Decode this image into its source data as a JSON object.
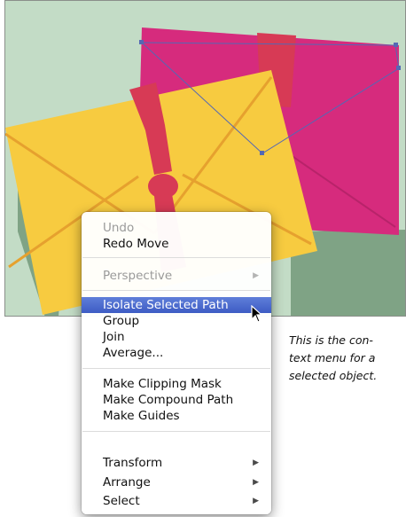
{
  "colors": {
    "canvas_background": "#c3dcc6",
    "shadow": "#7fa385",
    "pink_envelope": "#d62b7d",
    "yellow_envelope": "#f7cb40",
    "ribbon": "#d73a55",
    "selection_path": "#5468b4",
    "menu_highlight": "#4a68cc"
  },
  "context_menu": {
    "items": [
      {
        "label": "Undo",
        "enabled": false,
        "highlighted": false,
        "submenu": false
      },
      {
        "label": "Redo Move",
        "enabled": true,
        "highlighted": false,
        "submenu": false
      },
      {
        "label": "Perspective",
        "enabled": false,
        "highlighted": false,
        "submenu": true
      },
      {
        "label": "Isolate Selected Path",
        "enabled": true,
        "highlighted": true,
        "submenu": false
      },
      {
        "label": "Group",
        "enabled": true,
        "highlighted": false,
        "submenu": false
      },
      {
        "label": "Join",
        "enabled": true,
        "highlighted": false,
        "submenu": false
      },
      {
        "label": "Average...",
        "enabled": true,
        "highlighted": false,
        "submenu": false
      },
      {
        "label": "Make Clipping Mask",
        "enabled": true,
        "highlighted": false,
        "submenu": false
      },
      {
        "label": "Make Compound Path",
        "enabled": true,
        "highlighted": false,
        "submenu": false
      },
      {
        "label": "Make Guides",
        "enabled": true,
        "highlighted": false,
        "submenu": false
      },
      {
        "label": "Transform",
        "enabled": true,
        "highlighted": false,
        "submenu": true
      },
      {
        "label": "Arrange",
        "enabled": true,
        "highlighted": false,
        "submenu": true
      },
      {
        "label": "Select",
        "enabled": true,
        "highlighted": false,
        "submenu": true
      }
    ],
    "submenu_arrow": "▶"
  },
  "caption": {
    "lines": [
      "This is the con-",
      "text menu for a",
      "selected object."
    ]
  },
  "icons": {
    "cursor": "arrow-pointer-icon"
  }
}
